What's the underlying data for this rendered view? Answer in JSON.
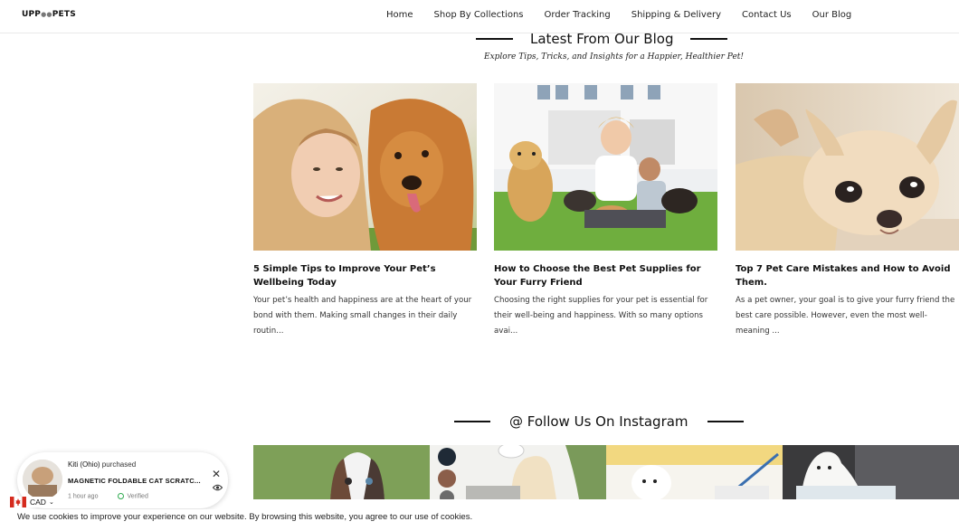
{
  "header": {
    "logo": "UPP",
    "logo_mid": "●●",
    "logo_end": "PETS",
    "nav": [
      "Home",
      "Shop By Collections",
      "Order Tracking",
      "Shipping & Delivery",
      "Contact Us",
      "Our Blog"
    ]
  },
  "blog": {
    "title": "Latest From Our Blog",
    "subtitle": "Explore Tips, Tricks, and Insights for a Happier, Healthier Pet!",
    "posts": [
      {
        "title": "5 Simple Tips to Improve Your Pet’s Wellbeing Today",
        "excerpt": "Your pet’s health and happiness are at the heart of your bond with them. Making small changes in their daily routin..."
      },
      {
        "title": "How to Choose the Best Pet Supplies for Your Furry Friend",
        "excerpt": "Choosing the right supplies for your pet is essential for their well-being and happiness. With so many options avai..."
      },
      {
        "title": "Top 7 Pet Care Mistakes and How to Avoid Them.",
        "excerpt": "As a pet owner, your goal is to give your furry friend the best care possible. However, even the most well-meaning ..."
      }
    ]
  },
  "instagram": {
    "title": "@ Follow Us On Instagram"
  },
  "popup": {
    "buyer": "Kiti (Ohio)",
    "action": "purchased",
    "product": "MAGNETIC FOLDABLE CAT SCRATC...",
    "meta": "1 hour ago",
    "verified": "Verified",
    "close": "✕"
  },
  "currency": {
    "code": "CAD",
    "chevron": "⌄"
  },
  "cookie": {
    "text": "We use cookies to improve your experience on our website. By browsing this website, you agree to our use of cookies."
  }
}
